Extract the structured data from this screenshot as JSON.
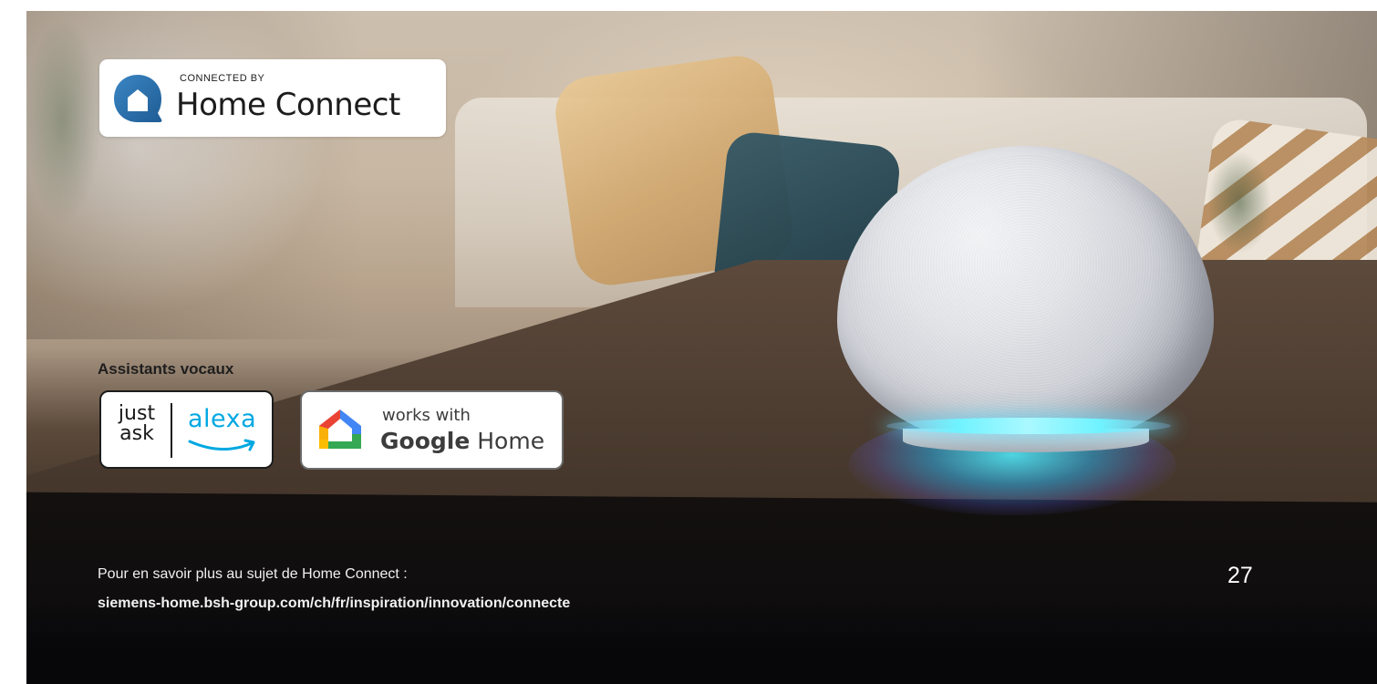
{
  "home_connect": {
    "connected_by": "CONNECTED BY",
    "brand": "Home Connect",
    "icon": "home-connect-house-icon",
    "color": "#2e6fa6"
  },
  "assistants": {
    "heading": "Assistants vocaux",
    "alexa": {
      "just": "just",
      "ask": "ask",
      "word": "alexa",
      "color": "#00a8e1"
    },
    "google": {
      "works_with": "works with",
      "brand": "Google",
      "product": "Home",
      "icon": "google-home-icon"
    }
  },
  "footer": {
    "text": "Pour en savoir plus au sujet de Home Connect :",
    "link": "siemens-home.bsh-group.com/ch/fr/inspiration/innovation/connecte"
  },
  "page_number": "27"
}
